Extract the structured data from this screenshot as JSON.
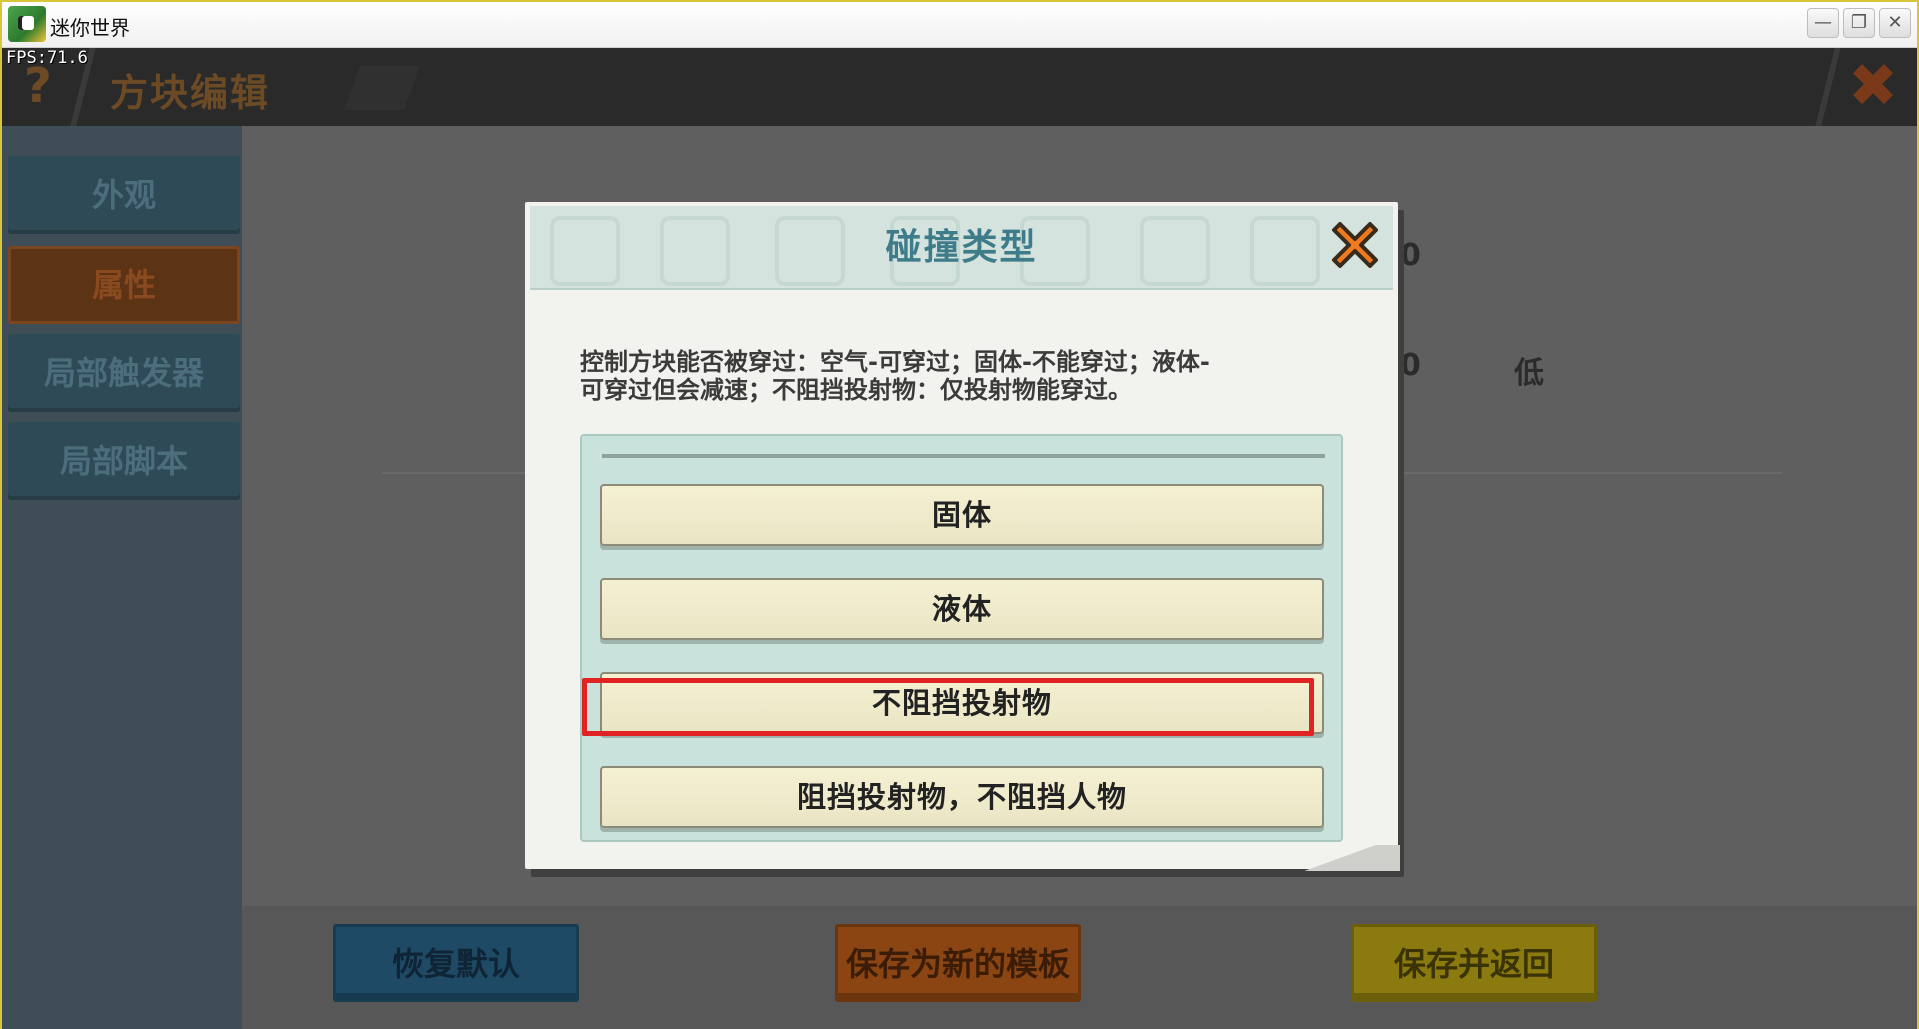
{
  "window": {
    "title": "迷你世界",
    "min_glyph": "—",
    "restore_glyph": "❐",
    "close_glyph": "✕"
  },
  "fps": "FPS:71.6",
  "header": {
    "help_glyph": "?",
    "title": "方块编辑",
    "close_glyph": "✖"
  },
  "sidebar": {
    "items": [
      {
        "label": "外观",
        "active": false
      },
      {
        "label": "属性",
        "active": true
      },
      {
        "label": "局部触发器",
        "active": false
      },
      {
        "label": "局部脚本",
        "active": false
      }
    ]
  },
  "background": {
    "value1": "0",
    "value2": "0",
    "level_label": "低"
  },
  "bottom_buttons": {
    "reset": "恢复默认",
    "save_template": "保存为新的模板",
    "save_return": "保存并返回"
  },
  "modal": {
    "title": "碰撞类型",
    "description_line1": "控制方块能否被穿过：空气-可穿过；固体-不能穿过；液体-",
    "description_line2": "可穿过但会减速；不阻挡投射物：仅投射物能穿过。",
    "options": [
      "固体",
      "液体",
      "不阻挡投射物",
      "阻挡投射物，不阻挡人物"
    ],
    "highlighted_option": "不阻挡投射物"
  },
  "colors": {
    "highlight": "#e02424",
    "modal_title": "#3f7c8a",
    "option_bg": "#f4f0d2",
    "close_orange": "#f07a1e"
  }
}
